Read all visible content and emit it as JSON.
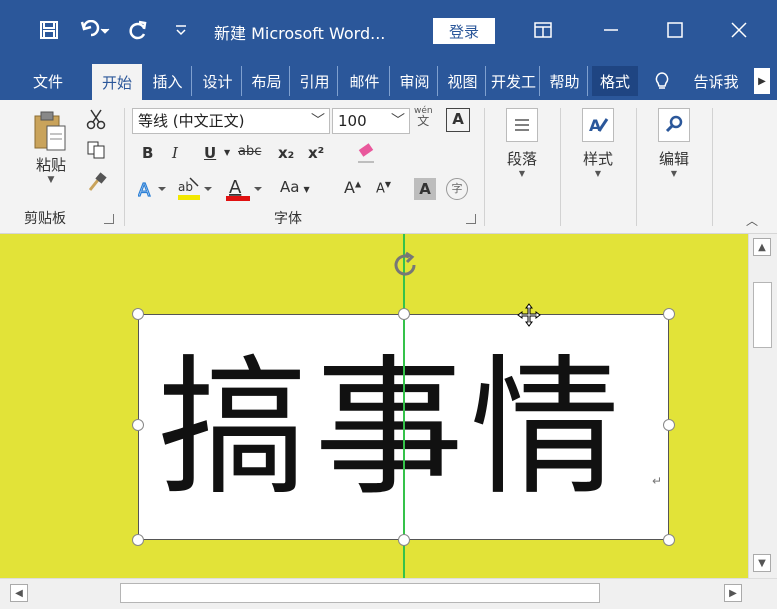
{
  "titlebar": {
    "title": "新建 Microsoft Word...",
    "login": "登录",
    "icons": [
      "save-icon",
      "undo-icon",
      "redo-icon",
      "customize-qat-icon",
      "ribbon-display-icon",
      "minimize-icon",
      "maximize-icon",
      "close-icon"
    ]
  },
  "tabs": [
    "文件",
    "开始",
    "插入",
    "设计",
    "布局",
    "引用",
    "邮件",
    "审阅",
    "视图",
    "开发工",
    "帮助",
    "格式"
  ],
  "tell_me": "告诉我",
  "ribbon": {
    "clipboard": {
      "paste": "粘贴",
      "label": "剪贴板"
    },
    "font": {
      "name": "等线 (中文正文)",
      "size": "100",
      "bold": "B",
      "italic": "I",
      "underline": "U",
      "strike": "abc",
      "subscript": "x₂",
      "superscript": "x²",
      "grow": "A",
      "shrink": "A",
      "clear_letter": "Aa",
      "shade_letter": "A",
      "circled": "字",
      "pinyin_top": "wén",
      "pinyin_bottom": "文",
      "label": "字体"
    },
    "paragraph": {
      "label": "段落"
    },
    "styles": {
      "label": "样式"
    },
    "editing": {
      "label": "编辑"
    }
  },
  "document": {
    "textbox_text": "搞事情",
    "pilcrow": "↵"
  },
  "colors": {
    "accent": "#2b579a",
    "page_bg": "#e2e338",
    "guide": "#35c24a",
    "font_color_bar": "#e01010",
    "highlight_bar": "#f2e800"
  }
}
